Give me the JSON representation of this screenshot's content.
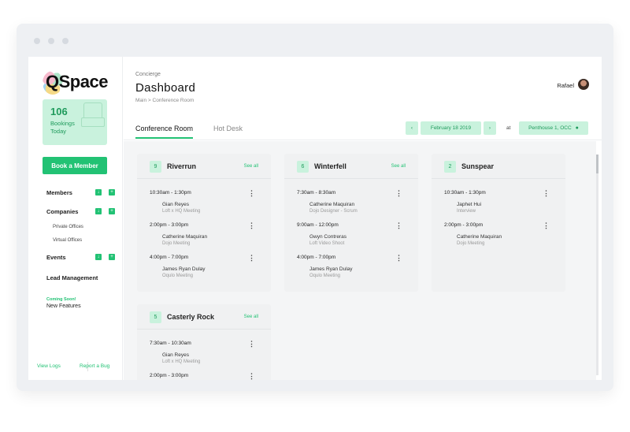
{
  "brand": {
    "logo_text": "QSpace"
  },
  "stats": {
    "bookings_count": "106",
    "bookings_label": "Bookings Today"
  },
  "sidebar": {
    "book_button": "Book a Member",
    "members": "Members",
    "companies": "Companies",
    "private_offices": "Private Offices",
    "virtual_offices": "Virtual Offices",
    "events": "Events",
    "lead_management": "Lead Management",
    "coming_soon": "Coming Soon!",
    "new_features": "New Features",
    "view_logs": "View Logs",
    "report_bug": "Report a Bug"
  },
  "header": {
    "section": "Concierge",
    "title": "Dashboard",
    "breadcrumb": "Main  >  Conference Room",
    "user_name": "Rafael"
  },
  "tabs": [
    {
      "label": "Conference Room",
      "active": true
    },
    {
      "label": "Hot Desk",
      "active": false
    }
  ],
  "filters": {
    "prev": "‹",
    "date": "February   18   2019",
    "next": "›",
    "at": "at",
    "location": "Penthouse 1, OCC"
  },
  "rooms": [
    {
      "count": "9",
      "name": "Riverrun",
      "see_all": "See all",
      "bookings": [
        {
          "time": "10:30am - 1:30pm",
          "who": "Gian Reyes",
          "what": "Loft x HQ Meeting"
        },
        {
          "time": "2:00pm - 3:00pm",
          "who": "Catherine Maquiran",
          "what": "Dojo Meeting"
        },
        {
          "time": "4:00pm - 7:00pm",
          "who": "James Ryan Dulay",
          "what": "Oqulo Meeting"
        }
      ]
    },
    {
      "count": "6",
      "name": "Winterfell",
      "see_all": "See all",
      "bookings": [
        {
          "time": "7:30am - 8:30am",
          "who": "Catherine Maquiran",
          "what": "Dojo Designer - Scrum"
        },
        {
          "time": "9:00am - 12:00pm",
          "who": "Gwyn Contreras",
          "what": "Loft Video Shoot"
        },
        {
          "time": "4:00pm - 7:00pm",
          "who": "James Ryan Dulay",
          "what": "Oqulo Meeting"
        }
      ]
    },
    {
      "count": "2",
      "name": "Sunspear",
      "see_all": "",
      "bookings": [
        {
          "time": "10:30am - 1:30pm",
          "who": "Japhet Hui",
          "what": "Interview"
        },
        {
          "time": "2:00pm - 3:00pm",
          "who": "Catherine Maquiran",
          "what": "Dojo Meeting"
        }
      ]
    },
    {
      "count": "5",
      "name": "Casterly Rock",
      "see_all": "See all",
      "bookings": [
        {
          "time": "7:30am - 10:30am",
          "who": "Gian Reyes",
          "what": "Loft x HQ Meeting"
        },
        {
          "time": "2:00pm - 3:00pm",
          "who": "",
          "what": ""
        }
      ]
    }
  ],
  "colors": {
    "accent": "#22c274",
    "accent_light": "#c9f2dd"
  }
}
